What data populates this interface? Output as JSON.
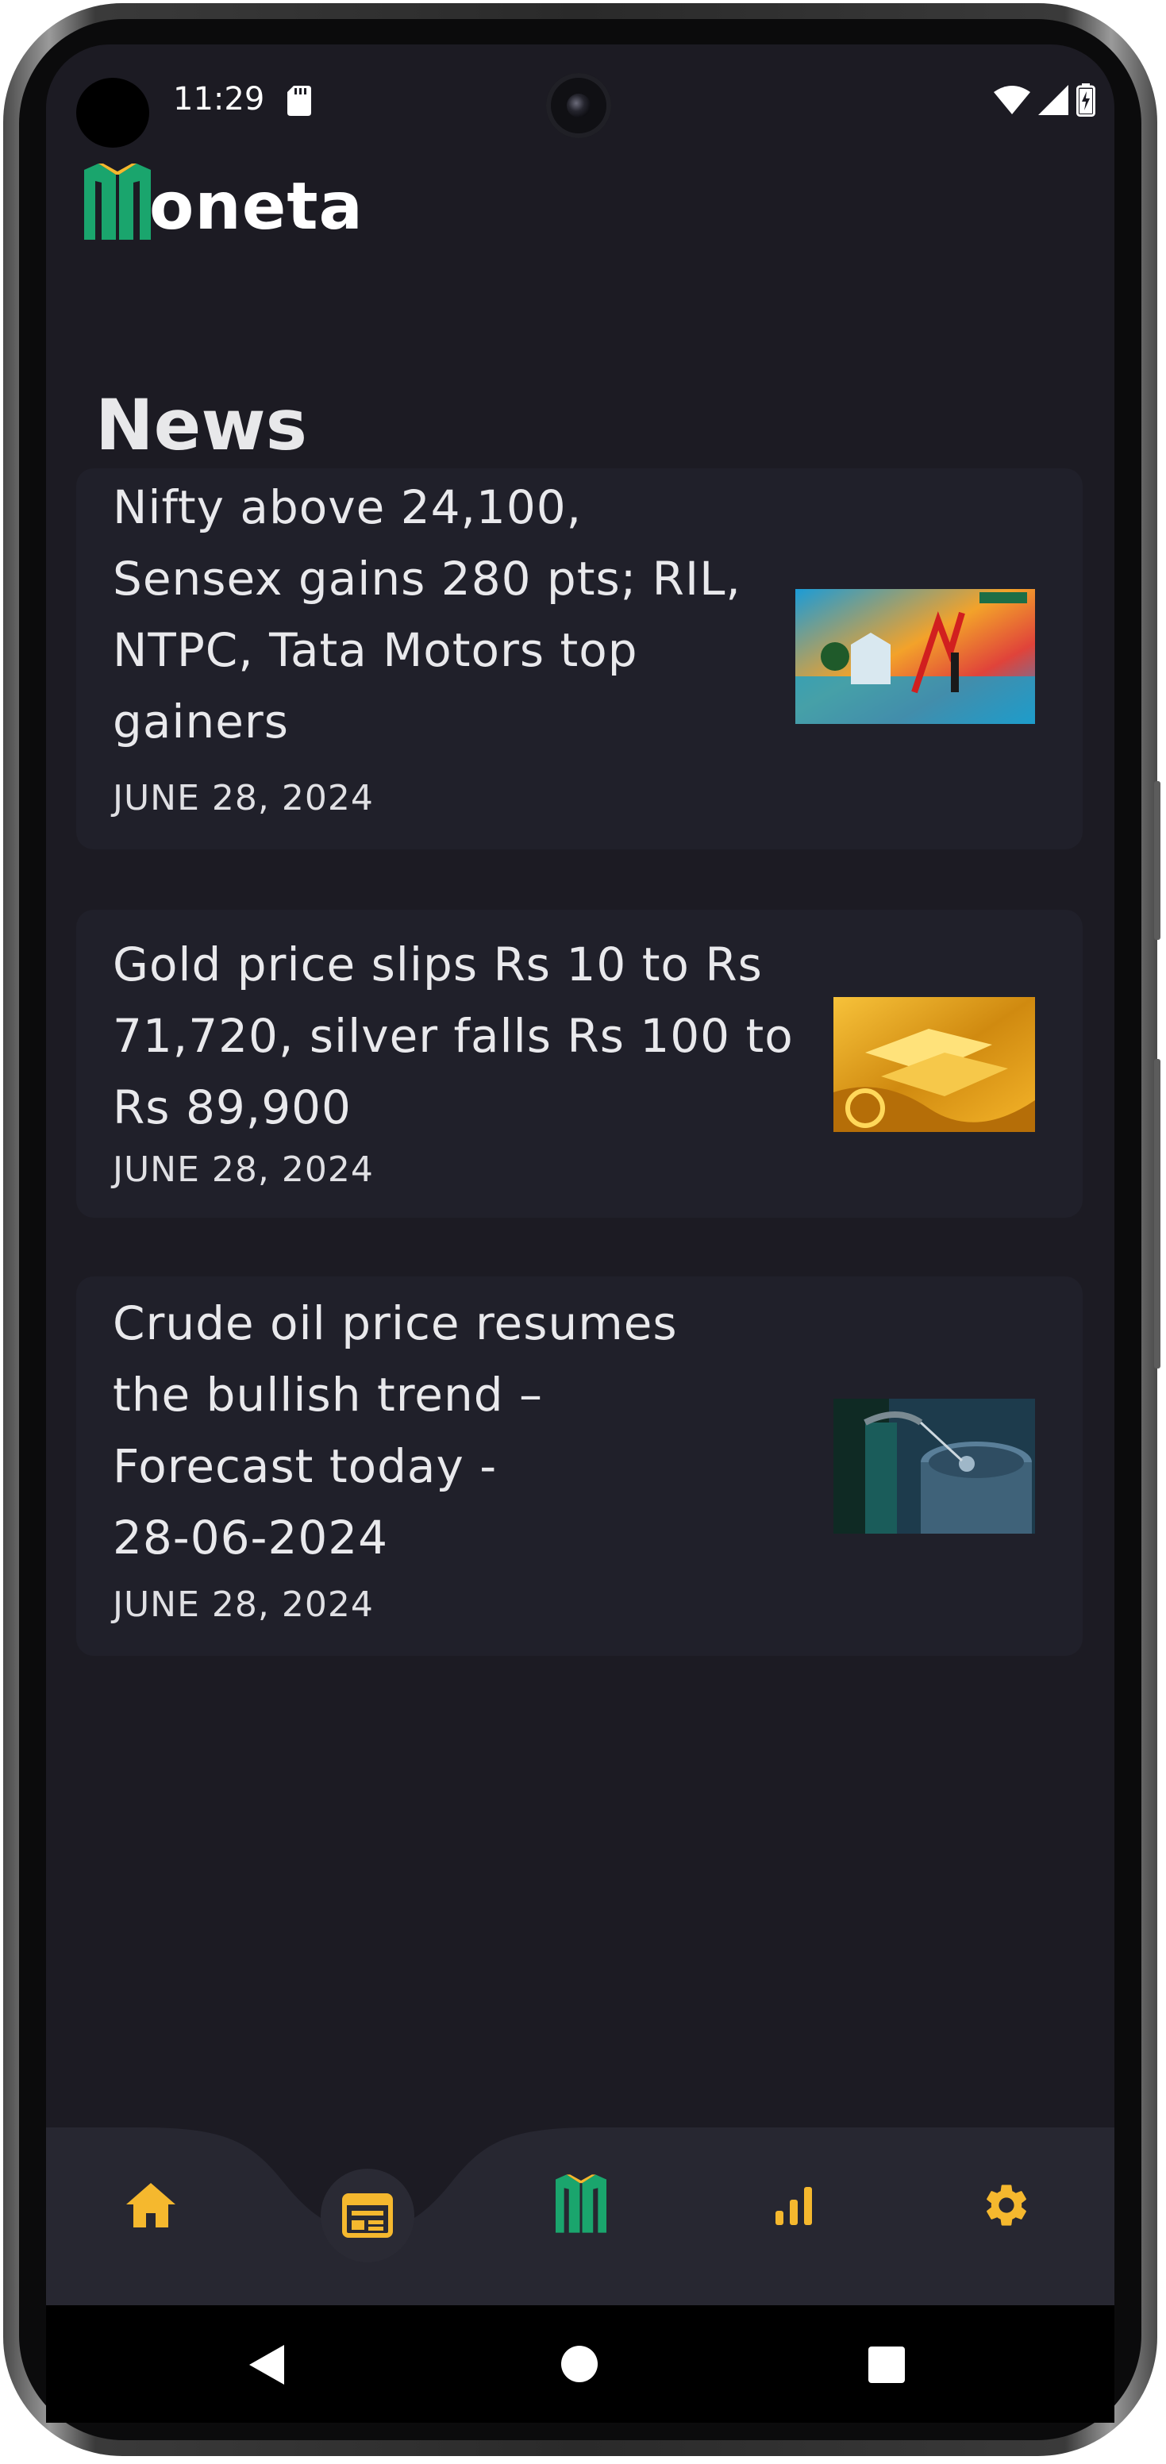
{
  "status_bar": {
    "time": "11:29",
    "icons": [
      "sd-card-icon",
      "wifi-icon",
      "signal-icon",
      "battery-charging-icon"
    ]
  },
  "app": {
    "logo_text": "oneta",
    "logo_mark_color": "#1aa56d"
  },
  "page": {
    "title": "News"
  },
  "news": [
    {
      "headline_lines": [
        "Nifty above 24,100,",
        "Sensex gains 280 pts; RIL,",
        "NTPC, Tata Motors top",
        "gainers"
      ],
      "date": "JUNE 28, 2024",
      "thumbnail": "stock-market-bull-image"
    },
    {
      "headline_lines": [
        "Gold price slips Rs 10 to Rs",
        "71,720, silver falls Rs 100 to",
        "Rs 89,900"
      ],
      "date": "JUNE 28, 2024",
      "thumbnail": "gold-bars-image"
    },
    {
      "headline_lines": [
        "Crude oil price resumes",
        "the bullish trend –",
        "Forecast today -",
        "28-06-2024"
      ],
      "date": "JUNE 28, 2024",
      "thumbnail": "oil-barrel-image"
    }
  ],
  "bottom_nav": {
    "items": [
      {
        "name": "home",
        "icon": "home-icon"
      },
      {
        "name": "news",
        "icon": "newspaper-icon",
        "active": true
      },
      {
        "name": "moneta",
        "icon": "moneta-logo-icon"
      },
      {
        "name": "stats",
        "icon": "bar-chart-icon"
      },
      {
        "name": "settings",
        "icon": "gear-icon"
      }
    ],
    "accent_color": "#f5b82e",
    "background": "#272731"
  },
  "system_nav": {
    "buttons": [
      "back-icon",
      "home-circle-icon",
      "recents-icon"
    ]
  }
}
